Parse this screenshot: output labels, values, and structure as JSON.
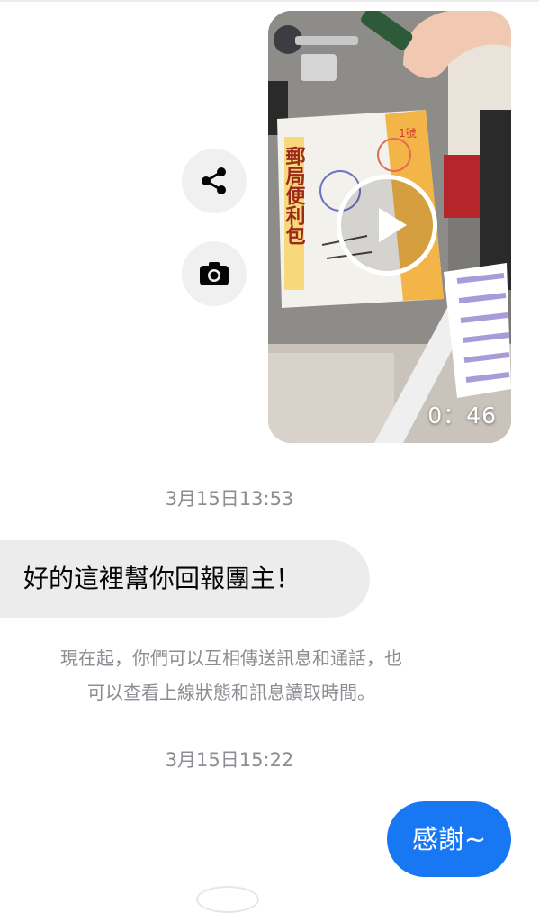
{
  "video": {
    "duration": "0：46",
    "package_label": "郵局便利包",
    "package_size": "1號"
  },
  "actions": {
    "share_icon": "share-icon",
    "camera_icon": "camera-icon"
  },
  "timestamps": [
    "3月15日13:53",
    "3月15日15:22"
  ],
  "messages": {
    "incoming": "好的這裡幫你回報團主！",
    "outgoing": "感謝~"
  },
  "notice": {
    "line1": "現在起，你們可以互相傳送訊息和通話，也",
    "line2": "可以查看上線狀態和訊息讀取時間。"
  },
  "colors": {
    "sent_bubble": "#1877f2",
    "received_bubble": "#ececec",
    "meta_text": "#8a8d91"
  }
}
